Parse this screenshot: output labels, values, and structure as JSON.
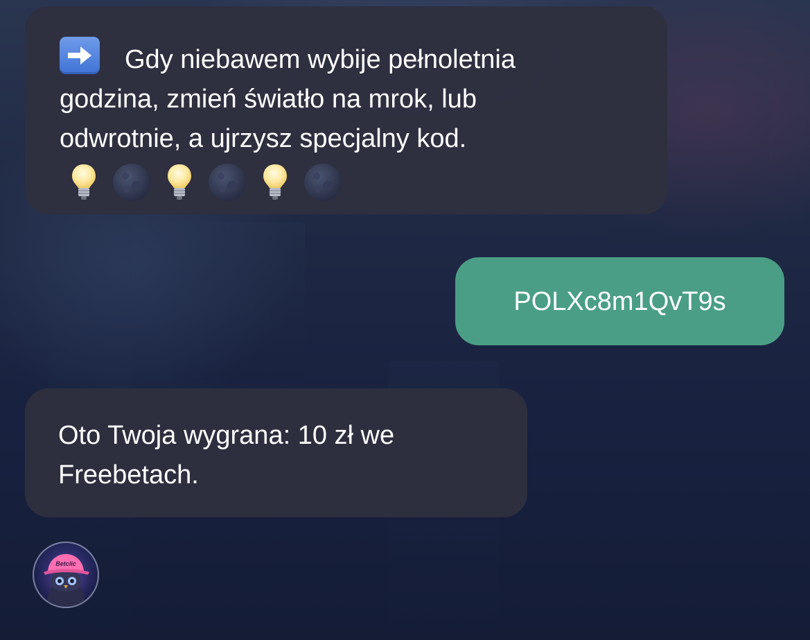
{
  "messages": [
    {
      "id": "msg1",
      "direction": "incoming",
      "icon": "right-arrow-icon",
      "lines": [
        "Gdy niebawem wybije pełnoletnia",
        "godzina, zmień światło na mrok, lub",
        "odwrotnie, a ujrzysz specjalny kod."
      ],
      "emoji_sequence": [
        "light-bulb-icon",
        "new-moon-icon",
        "light-bulb-icon",
        "new-moon-icon",
        "light-bulb-icon",
        "new-moon-icon"
      ]
    },
    {
      "id": "msg2",
      "direction": "outgoing",
      "text": "POLXc8m1QvT9s"
    },
    {
      "id": "msg3",
      "direction": "incoming",
      "lines": [
        "Oto Twoja wygrana: 10 zł we",
        "Freebetach."
      ]
    }
  ],
  "avatar": {
    "icon": "bot-avatar-icon",
    "cap_text": "Betclic"
  },
  "colors": {
    "incoming_bubble": "#2e2f3f",
    "outgoing_bubble": "#4a9e86",
    "text": "#ffffff",
    "background": "#1c2642"
  }
}
